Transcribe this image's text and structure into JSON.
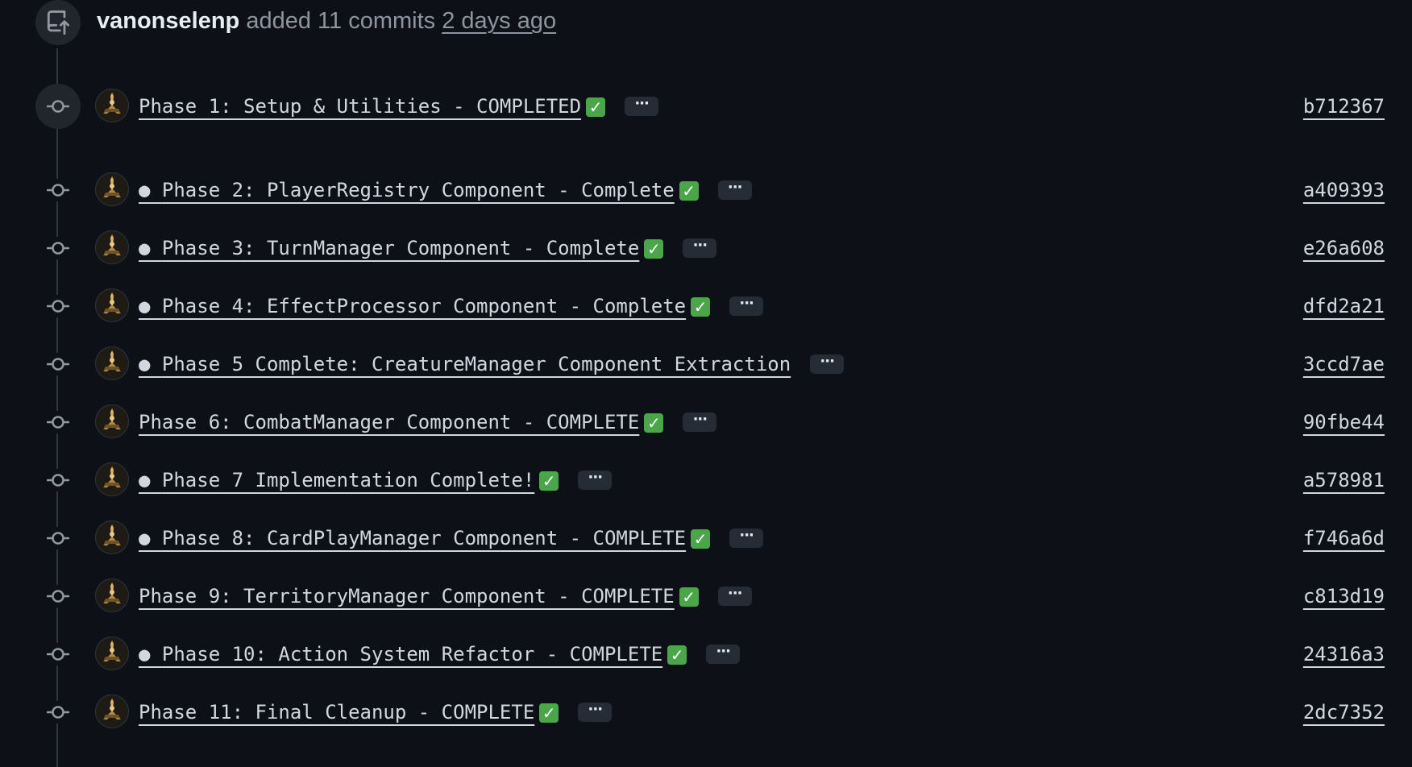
{
  "event": {
    "author": "vanonselenp",
    "action": "added 11 commits",
    "time": "2 days ago"
  },
  "icons": {
    "event_icon": "repo-push-icon",
    "node_icon": "git-commit-icon",
    "more_icon": "ellipsis-icon",
    "check_icon": "white-check-mark-emoji"
  },
  "colors": {
    "background": "#0d1117",
    "check_green": "#4ca54b",
    "muted_text": "#8d96a0"
  },
  "commits": [
    {
      "message": "Phase 1: Setup & Utilities - COMPLETED",
      "bullet": false,
      "check": true,
      "sha": "b712367",
      "highlighted": true
    },
    {
      "message": "Phase 2: PlayerRegistry Component - Complete",
      "bullet": true,
      "check": true,
      "sha": "a409393",
      "highlighted": false
    },
    {
      "message": "Phase 3: TurnManager Component - Complete",
      "bullet": true,
      "check": true,
      "sha": "e26a608",
      "highlighted": false
    },
    {
      "message": "Phase 4: EffectProcessor Component - Complete",
      "bullet": true,
      "check": true,
      "sha": "dfd2a21",
      "highlighted": false
    },
    {
      "message": "Phase 5 Complete: CreatureManager Component Extraction",
      "bullet": true,
      "check": false,
      "sha": "3ccd7ae",
      "highlighted": false
    },
    {
      "message": "Phase 6: CombatManager Component - COMPLETE",
      "bullet": false,
      "check": true,
      "sha": "90fbe44",
      "highlighted": false
    },
    {
      "message": "Phase 7 Implementation Complete!",
      "bullet": true,
      "check": true,
      "sha": "a578981",
      "highlighted": false
    },
    {
      "message": "Phase 8: CardPlayManager Component - COMPLETE",
      "bullet": true,
      "check": true,
      "sha": "f746a6d",
      "highlighted": false
    },
    {
      "message": "Phase 9: TerritoryManager Component - COMPLETE",
      "bullet": false,
      "check": true,
      "sha": "c813d19",
      "highlighted": false
    },
    {
      "message": "Phase 10: Action System Refactor - COMPLETE",
      "bullet": true,
      "check": true,
      "sha": "24316a3",
      "highlighted": false
    },
    {
      "message": "Phase 11: Final Cleanup - COMPLETE",
      "bullet": false,
      "check": true,
      "sha": "2dc7352",
      "highlighted": false
    }
  ]
}
